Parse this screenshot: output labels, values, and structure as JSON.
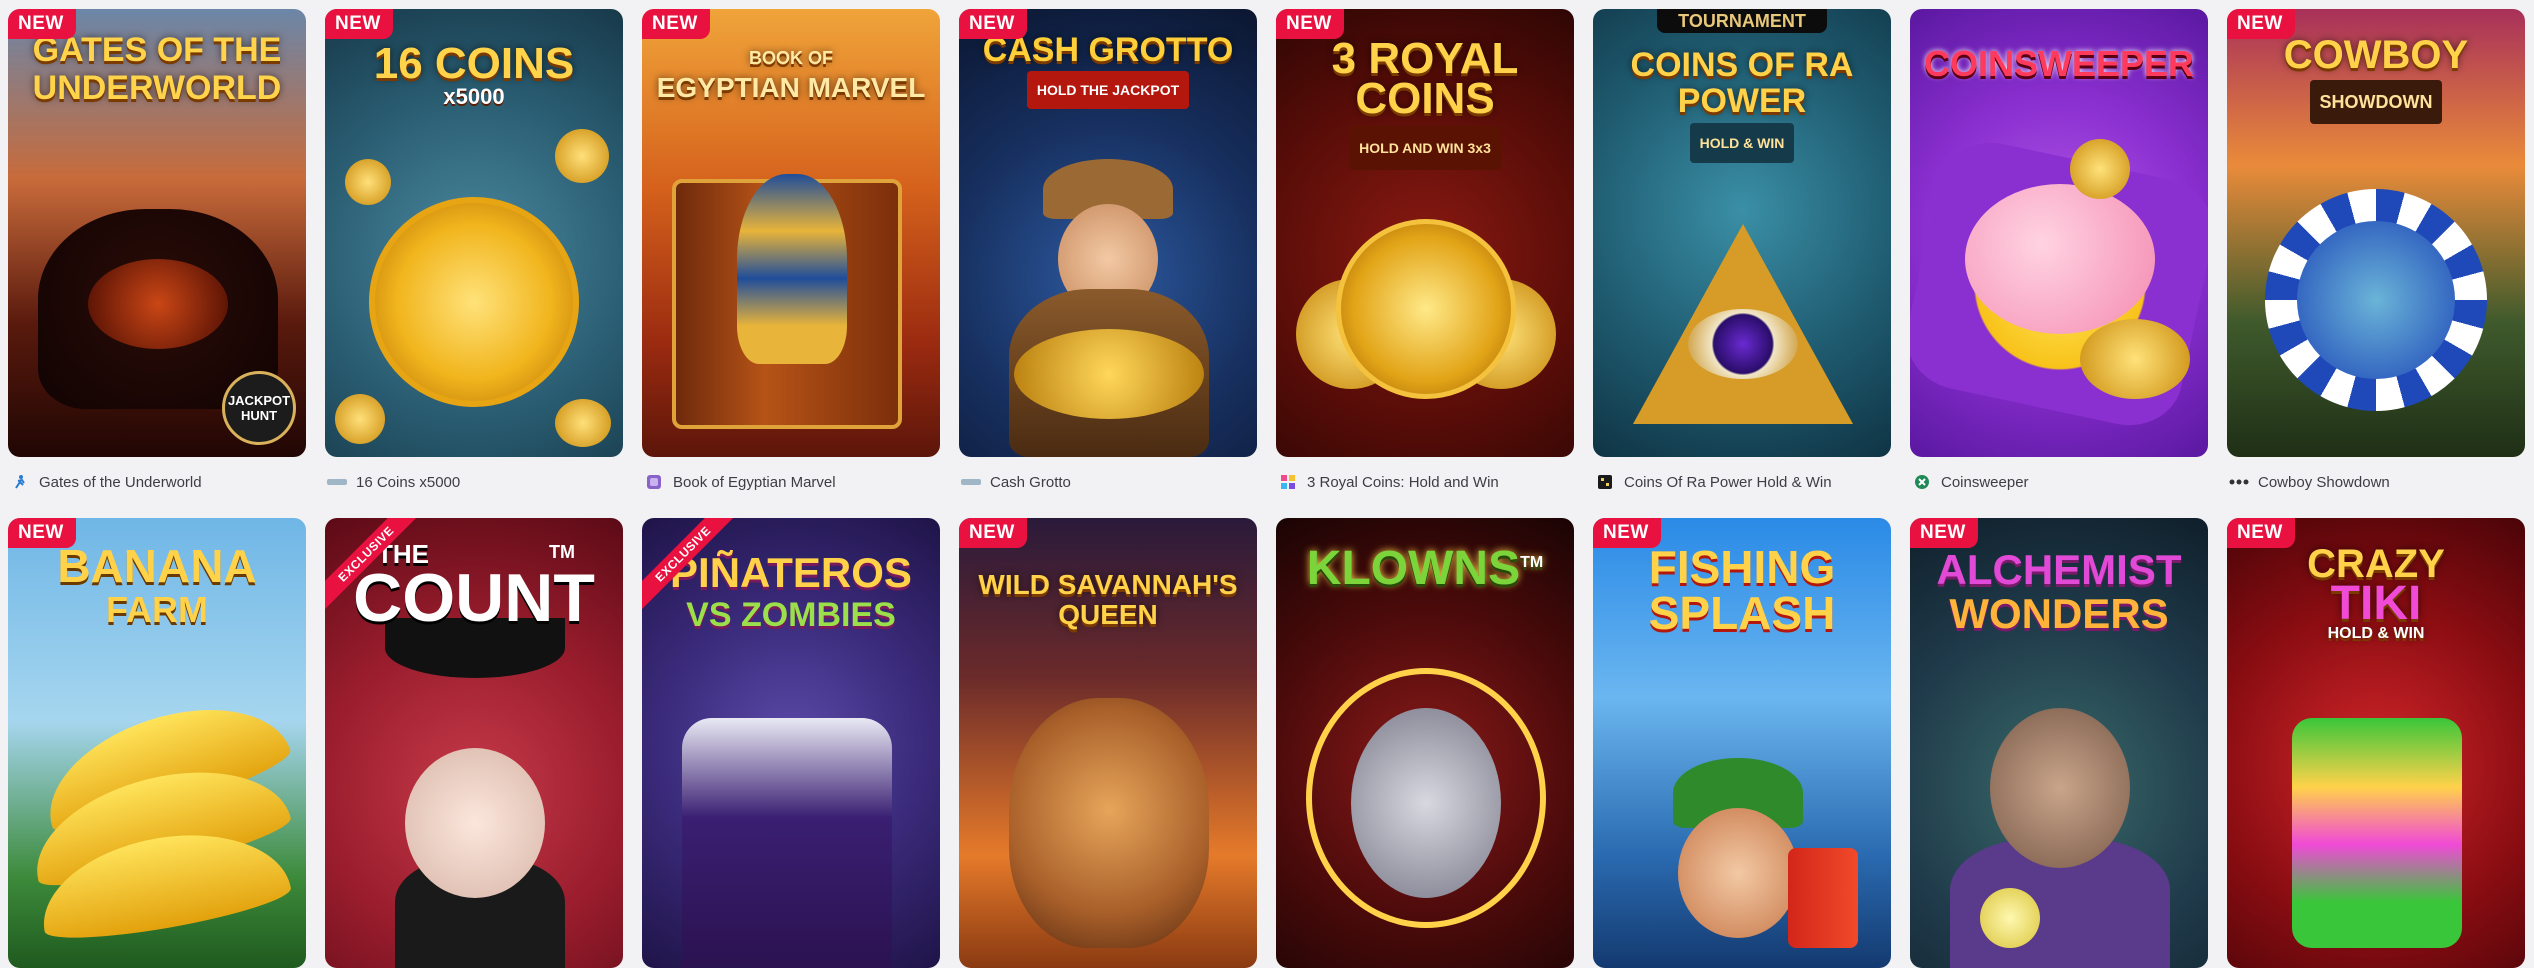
{
  "badges": {
    "new": "NEW",
    "exclusive": "EXCLUSIVE"
  },
  "row1": [
    {
      "title": "Gates of the Underworld",
      "logo": [
        "GATES OF THE",
        "UNDERWORLD"
      ],
      "extra": "JACKPOT HUNT",
      "is_new": true,
      "provider_icon": "runner-provider-icon"
    },
    {
      "title": "16 Coins x5000",
      "logo": [
        "16 COINS",
        "x5000"
      ],
      "is_new": true,
      "provider_icon": "wazdan-provider-icon"
    },
    {
      "title": "Book of Egyptian Marvel",
      "logo": [
        "BOOK OF",
        "EGYPTIAN MARVEL"
      ],
      "is_new": true,
      "provider_icon": "purple-provider-icon"
    },
    {
      "title": "Cash Grotto",
      "logo": [
        "CASH GROTTO",
        "HOLD THE JACKPOT"
      ],
      "is_new": true,
      "provider_icon": "wazdan-provider-icon"
    },
    {
      "title": "3 Royal Coins: Hold and Win",
      "logo": [
        "3 ROYAL",
        "COINS",
        "HOLD AND WIN 3x3"
      ],
      "is_new": true,
      "provider_icon": "colorful-provider-icon"
    },
    {
      "title": "Coins Of Ra Power Hold & Win",
      "logo": [
        "TOURNAMENT",
        "COINS OF RA",
        "POWER",
        "HOLD & WIN"
      ],
      "is_new": false,
      "provider_icon": "black-square-provider-icon"
    },
    {
      "title": "Coinsweeper",
      "logo": [
        "COINSWEEPER"
      ],
      "is_new": false,
      "provider_icon": "green-circle-provider-icon"
    },
    {
      "title": "Cowboy Showdown",
      "logo": [
        "COWBOY",
        "SHOWDOWN"
      ],
      "is_new": true,
      "provider_icon": "dots-provider-icon"
    }
  ],
  "row2": [
    {
      "logo": [
        "BANANA",
        "FARM"
      ],
      "badge": "new"
    },
    {
      "logo": [
        "THE",
        "COUNT",
        "TM"
      ],
      "badge": "exclusive"
    },
    {
      "logo": [
        "PIÑATEROS",
        "VS ZOMBIES"
      ],
      "badge": "exclusive"
    },
    {
      "logo": [
        "WILD SAVANNAH'S",
        "QUEEN"
      ],
      "badge": "new"
    },
    {
      "logo": [
        "KLOWNS",
        "TM"
      ],
      "badge": "none"
    },
    {
      "logo": [
        "FISHING",
        "SPLASH"
      ],
      "badge": "new"
    },
    {
      "logo": [
        "ALCHEMIST",
        "WONDERS"
      ],
      "badge": "new"
    },
    {
      "logo": [
        "CRAZY",
        "TIKI",
        "HOLD & WIN"
      ],
      "badge": "new"
    }
  ]
}
